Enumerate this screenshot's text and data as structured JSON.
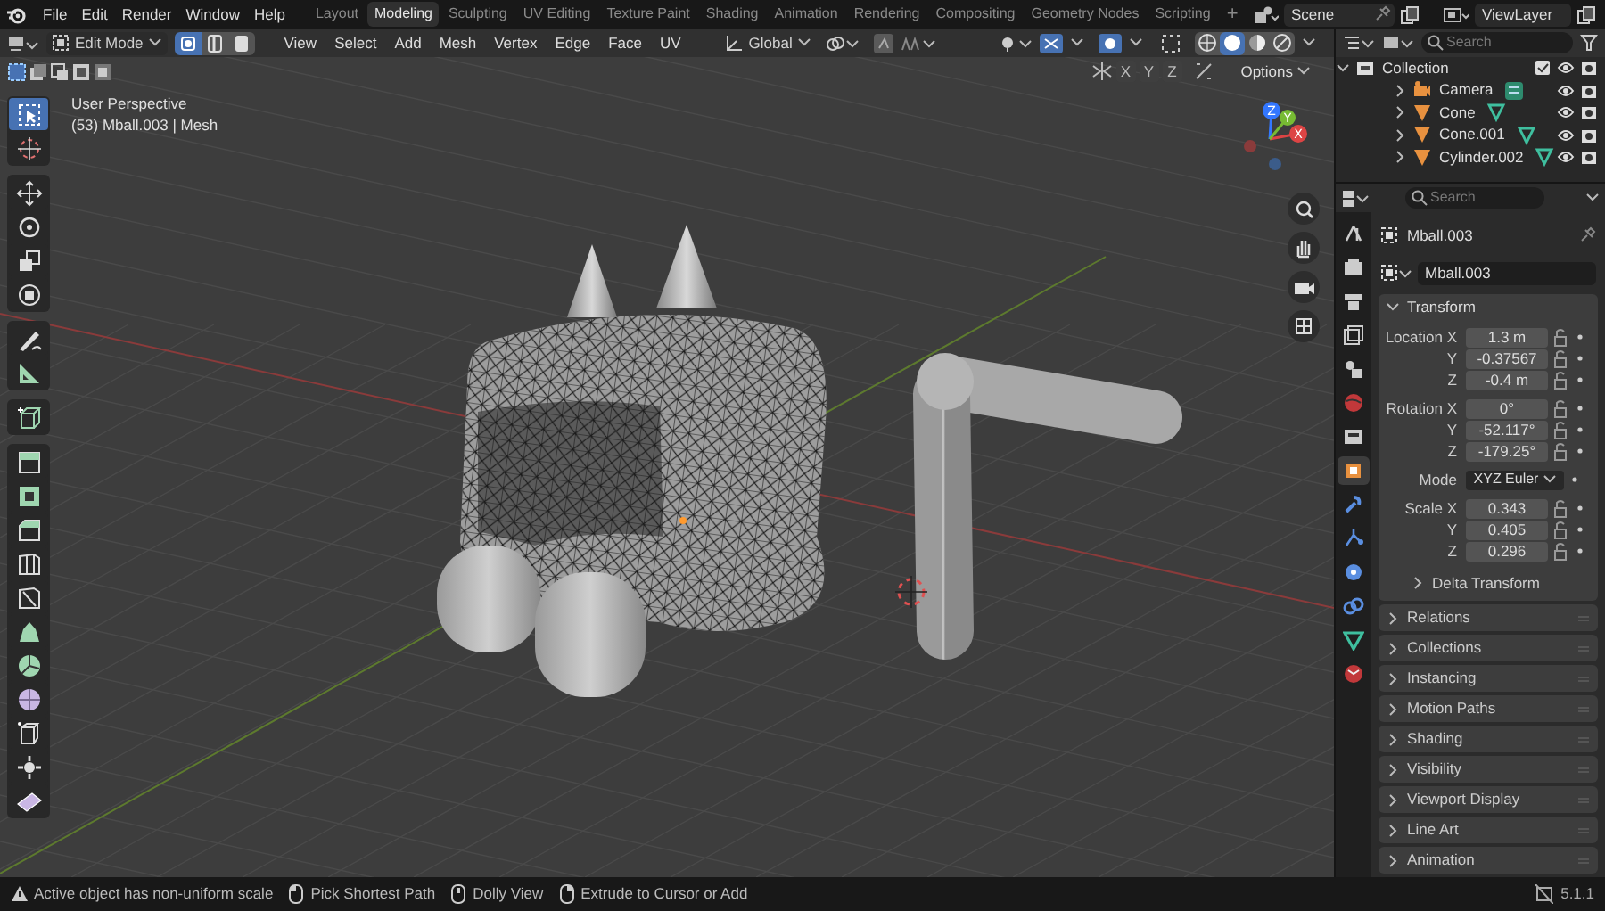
{
  "menu": [
    "File",
    "Edit",
    "Render",
    "Window",
    "Help"
  ],
  "workspaces": [
    {
      "label": "Layout",
      "selected": false
    },
    {
      "label": "Modeling",
      "selected": true
    },
    {
      "label": "Sculpting",
      "selected": false
    },
    {
      "label": "UV Editing",
      "selected": false
    },
    {
      "label": "Texture Paint",
      "selected": false
    },
    {
      "label": "Shading",
      "selected": false
    },
    {
      "label": "Animation",
      "selected": false
    },
    {
      "label": "Rendering",
      "selected": false
    },
    {
      "label": "Compositing",
      "selected": false
    },
    {
      "label": "Geometry Nodes",
      "selected": false
    },
    {
      "label": "Scripting",
      "selected": false
    }
  ],
  "add_workspace": "+",
  "scene": "Scene",
  "view_layer": "ViewLayer",
  "header": {
    "mode": "Edit Mode",
    "select_modes": [
      {
        "kind": "vertex",
        "selected": true
      },
      {
        "kind": "edge",
        "selected": false
      },
      {
        "kind": "face",
        "selected": false
      }
    ],
    "menus": [
      "View",
      "Select",
      "Add",
      "Mesh",
      "Vertex",
      "Edge",
      "Face",
      "UV"
    ],
    "orientation": "Global",
    "mirror_axes": [
      "X",
      "Y",
      "Z"
    ],
    "options": "Options"
  },
  "viewport": {
    "title": "User Perspective",
    "subtitle": "(53) Mball.003 | Mesh",
    "gizmo_axes": [
      "X",
      "Y",
      "Z"
    ]
  },
  "toolbar": [
    [
      {
        "kind": "select",
        "selected": true
      },
      {
        "kind": "cursor",
        "selected": false
      }
    ],
    [
      {
        "kind": "move",
        "selected": false
      },
      {
        "kind": "rotate",
        "selected": false
      },
      {
        "kind": "scale",
        "selected": false
      },
      {
        "kind": "transform",
        "selected": false
      }
    ],
    [
      {
        "kind": "annotate",
        "selected": false
      },
      {
        "kind": "measure",
        "selected": false
      }
    ],
    [
      {
        "kind": "add-cube",
        "selected": false
      }
    ],
    [
      {
        "kind": "extrude",
        "selected": false
      },
      {
        "kind": "inset",
        "selected": false
      },
      {
        "kind": "bevel",
        "selected": false
      },
      {
        "kind": "loop-cut",
        "selected": false
      },
      {
        "kind": "knife",
        "selected": false
      },
      {
        "kind": "poly-build",
        "selected": false
      },
      {
        "kind": "spin",
        "selected": false
      },
      {
        "kind": "smooth",
        "selected": false
      },
      {
        "kind": "edge-slide",
        "selected": false
      },
      {
        "kind": "shrink",
        "selected": false
      },
      {
        "kind": "shear",
        "selected": false
      }
    ]
  ],
  "outliner": {
    "search": {
      "placeholder": "Search"
    },
    "items": [
      {
        "name": "Collection",
        "kind": "collection",
        "expanded": true,
        "children": [
          {
            "name": "Camera",
            "kind": "camera",
            "expanded": false
          },
          {
            "name": "Cone",
            "kind": "mesh",
            "expanded": false
          },
          {
            "name": "Cone.001",
            "kind": "mesh",
            "expanded": false
          },
          {
            "name": "Cylinder.002",
            "kind": "mesh",
            "expanded": false
          }
        ]
      }
    ]
  },
  "properties": {
    "search": {
      "placeholder": "Search"
    },
    "tabs": [
      {
        "kind": "tool",
        "selected": false
      },
      {
        "kind": "render",
        "selected": false
      },
      {
        "kind": "output",
        "selected": false
      },
      {
        "kind": "view-layer",
        "selected": false
      },
      {
        "kind": "scene",
        "selected": false
      },
      {
        "kind": "world",
        "selected": false
      },
      {
        "kind": "collection",
        "selected": false
      },
      {
        "kind": "object",
        "selected": true
      },
      {
        "kind": "modifier",
        "selected": false
      },
      {
        "kind": "particles",
        "selected": false
      },
      {
        "kind": "physics",
        "selected": false
      },
      {
        "kind": "constraints",
        "selected": false
      },
      {
        "kind": "data",
        "selected": false
      },
      {
        "kind": "material",
        "selected": false
      }
    ],
    "object_name": "Mball.003",
    "data_name": "Mball.003",
    "transform": {
      "title": "Transform",
      "expanded": true,
      "groups": [
        [
          {
            "kind": "number",
            "label": "Location X",
            "value": "1.3 m"
          },
          {
            "kind": "number",
            "label": "Y",
            "value": "-0.37567"
          },
          {
            "kind": "number",
            "label": "Z",
            "value": "-0.4 m"
          }
        ],
        [
          {
            "kind": "number",
            "label": "Rotation X",
            "value": "0°"
          },
          {
            "kind": "number",
            "label": "Y",
            "value": "-52.117°"
          },
          {
            "kind": "number",
            "label": "Z",
            "value": "-179.25°"
          }
        ],
        [
          {
            "kind": "dropdown",
            "label": "Mode",
            "value": "XYZ Euler"
          }
        ],
        [
          {
            "kind": "number",
            "label": "Scale X",
            "value": "0.343"
          },
          {
            "kind": "number",
            "label": "Y",
            "value": "0.405"
          },
          {
            "kind": "number",
            "label": "Z",
            "value": "0.296"
          }
        ]
      ],
      "subpanel": {
        "title": "Delta Transform",
        "expanded": false
      }
    },
    "panels": [
      {
        "title": "Relations",
        "expanded": false
      },
      {
        "title": "Collections",
        "expanded": false
      },
      {
        "title": "Instancing",
        "expanded": false
      },
      {
        "title": "Motion Paths",
        "expanded": false
      },
      {
        "title": "Shading",
        "expanded": false
      },
      {
        "title": "Visibility",
        "expanded": false
      },
      {
        "title": "Viewport Display",
        "expanded": false
      },
      {
        "title": "Line Art",
        "expanded": false
      },
      {
        "title": "Animation",
        "expanded": false
      }
    ]
  },
  "status": [
    {
      "kind": "warning",
      "text": "Active object has non-uniform scale"
    },
    {
      "kind": "mouse-left",
      "text": "Pick Shortest Path"
    },
    {
      "kind": "mouse-middle",
      "text": "Dolly View"
    },
    {
      "kind": "mouse-right",
      "text": "Extrude to Cursor or Add"
    }
  ],
  "version": "5.1.1"
}
